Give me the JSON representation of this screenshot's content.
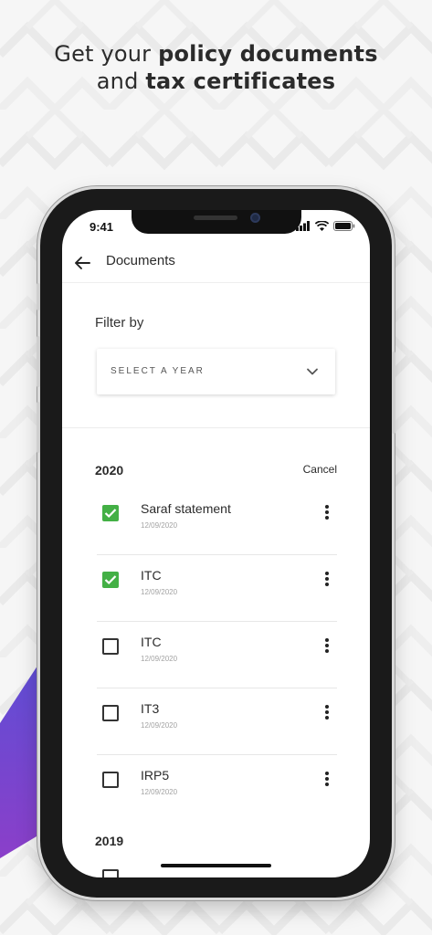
{
  "promo": {
    "line1_regular": "Get your ",
    "line1_bold": "policy documents",
    "line2_regular": "and ",
    "line2_bold": "tax certificates"
  },
  "status_bar": {
    "time": "9:41",
    "icons": [
      "cellular-signal-icon",
      "wifi-icon",
      "battery-icon"
    ]
  },
  "app_bar": {
    "back_icon": "arrow-left-icon",
    "title": "Documents"
  },
  "filter": {
    "label": "Filter by",
    "select_placeholder": "SELECT A YEAR",
    "select_icon": "chevron-down-icon"
  },
  "groups": [
    {
      "year": "2020",
      "cancel_label": "Cancel",
      "items": [
        {
          "name": "Saraf statement",
          "date": "12/09/2020",
          "checked": true
        },
        {
          "name": "ITC",
          "date": "12/09/2020",
          "checked": true
        },
        {
          "name": "ITC",
          "date": "12/09/2020",
          "checked": false
        },
        {
          "name": "IT3",
          "date": "12/09/2020",
          "checked": false
        },
        {
          "name": "IRP5",
          "date": "12/09/2020",
          "checked": false
        }
      ]
    },
    {
      "year": "2019"
    }
  ],
  "colors": {
    "check_green": "#43b045",
    "accent_purple": "#5a4fd6",
    "accent_violet": "#8b3fc9",
    "text_dark": "#2b2b2b",
    "date_gray": "#a3a3a3"
  }
}
